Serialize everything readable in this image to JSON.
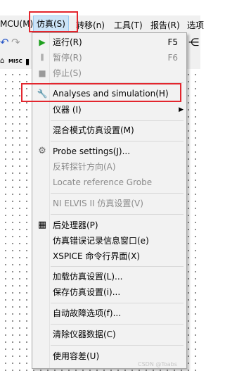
{
  "menubar": {
    "items": [
      "MCU(M)",
      "仿真(S)",
      "转移(n)",
      "工具(T)",
      "报告(R)",
      "选项"
    ]
  },
  "toolbar": {
    "misc_label": "MISC"
  },
  "menu": {
    "items": [
      {
        "icon": "play-icon",
        "label": "运行(R)",
        "shortcut": "F5",
        "disabled": false
      },
      {
        "icon": "pause-icon",
        "label": "暂停(R)",
        "shortcut": "F6",
        "disabled": true
      },
      {
        "icon": "stop-icon",
        "label": "停止(S)",
        "disabled": true
      },
      {
        "icon": "wrench-icon",
        "label": "Analyses and simulation(H)",
        "disabled": false
      },
      {
        "label": "仪器 (I)",
        "submenu": true,
        "disabled": false
      },
      {
        "label": "混合模式仿真设置(M)",
        "disabled": false
      },
      {
        "icon": "gear-icon",
        "label": "Probe settings(J)...",
        "disabled": false
      },
      {
        "label": "反转探针方向(A)",
        "disabled": true
      },
      {
        "label": "Locate reference Grobe",
        "disabled": true
      },
      {
        "label": "NI ELVIS II 仿真设置(V)",
        "disabled": true
      },
      {
        "icon": "calculator-icon",
        "label": "后处理器(P)",
        "disabled": false
      },
      {
        "label": "仿真错误记录信息窗口(e)",
        "disabled": false
      },
      {
        "label": "XSPICE 命令行界面(X)",
        "disabled": false
      },
      {
        "label": "加载仿真设置(L)...",
        "disabled": false
      },
      {
        "label": "保存仿真设置(i)...",
        "disabled": false
      },
      {
        "label": "自动故障选项(f)...",
        "disabled": false
      },
      {
        "label": "清除仪器数据(C)",
        "disabled": false
      },
      {
        "label": "使用容差(U)",
        "disabled": false
      }
    ]
  },
  "watermark": "CSDN @Toabs",
  "colors": {
    "highlight_box": "#e3262e",
    "menu_bg": "#f2f2f2",
    "play_green": "#1ea01e"
  }
}
